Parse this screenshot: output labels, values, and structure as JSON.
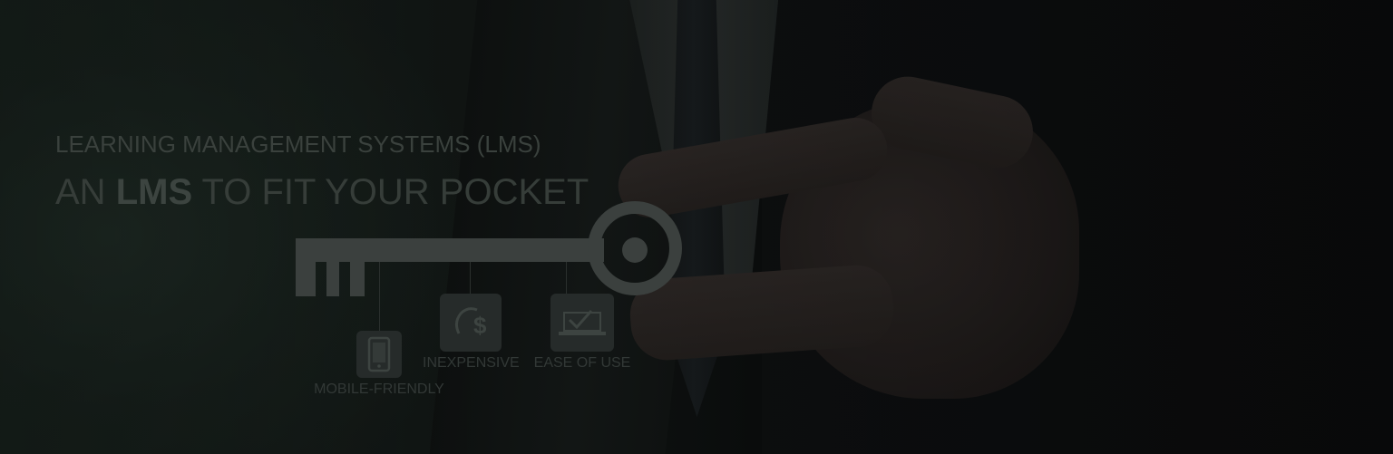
{
  "hero": {
    "subtitle": "LEARNING MANAGEMENT SYSTEMS (LMS)",
    "title_prefix": "AN ",
    "title_emphasis": "LMS",
    "title_suffix": " TO FIT YOUR POCKET"
  },
  "features": [
    {
      "label": "MOBILE-FRIENDLY",
      "icon": "mobile-phone-icon"
    },
    {
      "label": "INEXPENSIVE",
      "icon": "dollar-coin-icon"
    },
    {
      "label": "EASE OF USE",
      "icon": "checkmark-laptop-icon"
    }
  ],
  "colors": {
    "heading": "#3a413d",
    "key": "#3b403e",
    "background_dark": "#0c100e"
  }
}
